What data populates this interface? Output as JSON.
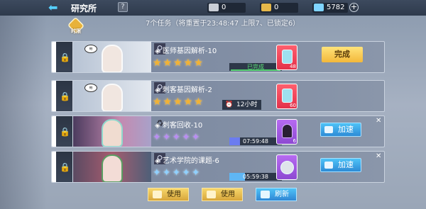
{
  "header": {
    "back_icon": "back-arrow-icon",
    "title": "研究所",
    "help_label": "?",
    "resources": [
      {
        "name": "document-ticket",
        "icon": "document-icon",
        "value": "0",
        "color": "#c9ced6"
      },
      {
        "name": "gold-ticket",
        "icon": "ticket-icon",
        "value": "0",
        "color": "#e6b84a"
      },
      {
        "name": "crystal",
        "icon": "crystal-icon",
        "value": "5782",
        "color": "#7fd4ff"
      }
    ],
    "plus_label": "+"
  },
  "summary": "7个任务（将重置于23:48:47 上限7、已锁定6）",
  "clock_badge_label": "时限",
  "tasks": [
    {
      "name": "◈ 医师基因解析-10",
      "stars": "★★★★★",
      "star_color": "gold",
      "status": "已完成",
      "item_qty": "48",
      "item_color": "red",
      "action": "完成"
    },
    {
      "name": "◈ 刺客基因解析-2",
      "stars": "★★★★★",
      "star_color": "gold",
      "timer": "12小时",
      "item_qty": "60",
      "item_color": "red"
    },
    {
      "name": "◈ 刺客回收-10",
      "stars": "✦✦✦✦✦",
      "star_color": "purple",
      "timer": "07:59:48",
      "item_qty": "6",
      "item_color": "purple",
      "action": "加速"
    },
    {
      "name": "◈ 艺术学院的课题-6",
      "stars": "✦✦✦✦✦",
      "star_color": "blue",
      "timer": "05:59:38",
      "item_qty": "",
      "item_color": "purple",
      "action": "加速"
    }
  ],
  "footer": {
    "use1": "使用",
    "use2": "使用",
    "refresh": "刷新"
  },
  "colors": {
    "accent": "#56d0ff",
    "gold_btn": "#f3b83a",
    "blue_btn": "#2d8bd6"
  }
}
